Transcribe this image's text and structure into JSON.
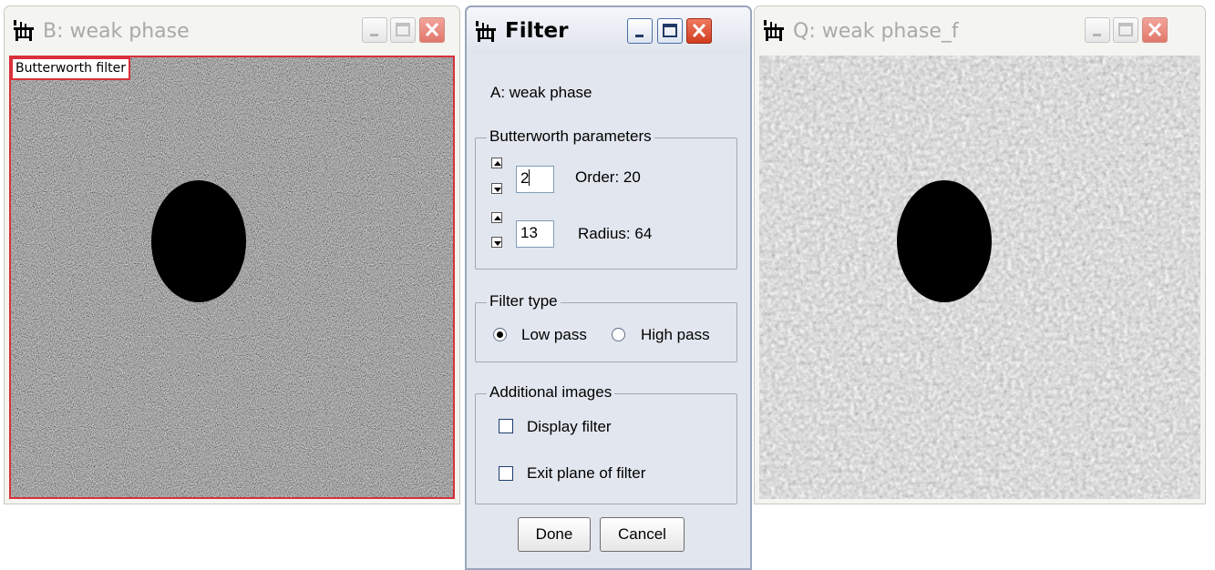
{
  "windows": {
    "left": {
      "title": "B: weak phase",
      "overlay_label": "Butterworth filter"
    },
    "right": {
      "title": "Q: weak phase_f"
    }
  },
  "dialog": {
    "title": "Filter",
    "source_label": "A: weak phase",
    "butterworth": {
      "legend": "Butterworth parameters",
      "order_value": "2",
      "order_label": "Order: 20",
      "radius_value": "13",
      "radius_label": "Radius: 64"
    },
    "filter_type": {
      "legend": "Filter type",
      "low_pass_label": "Low pass",
      "high_pass_label": "High pass",
      "selected": "Low pass"
    },
    "additional": {
      "legend": "Additional images",
      "display_filter_label": "Display filter",
      "display_filter_checked": false,
      "exit_plane_label": "Exit plane of filter",
      "exit_plane_checked": false
    },
    "done_label": "Done",
    "cancel_label": "Cancel"
  },
  "colors": {
    "accent_red": "#d9303a",
    "dialog_bg": "#e2e6ee",
    "close_red": "#d13c1f"
  }
}
